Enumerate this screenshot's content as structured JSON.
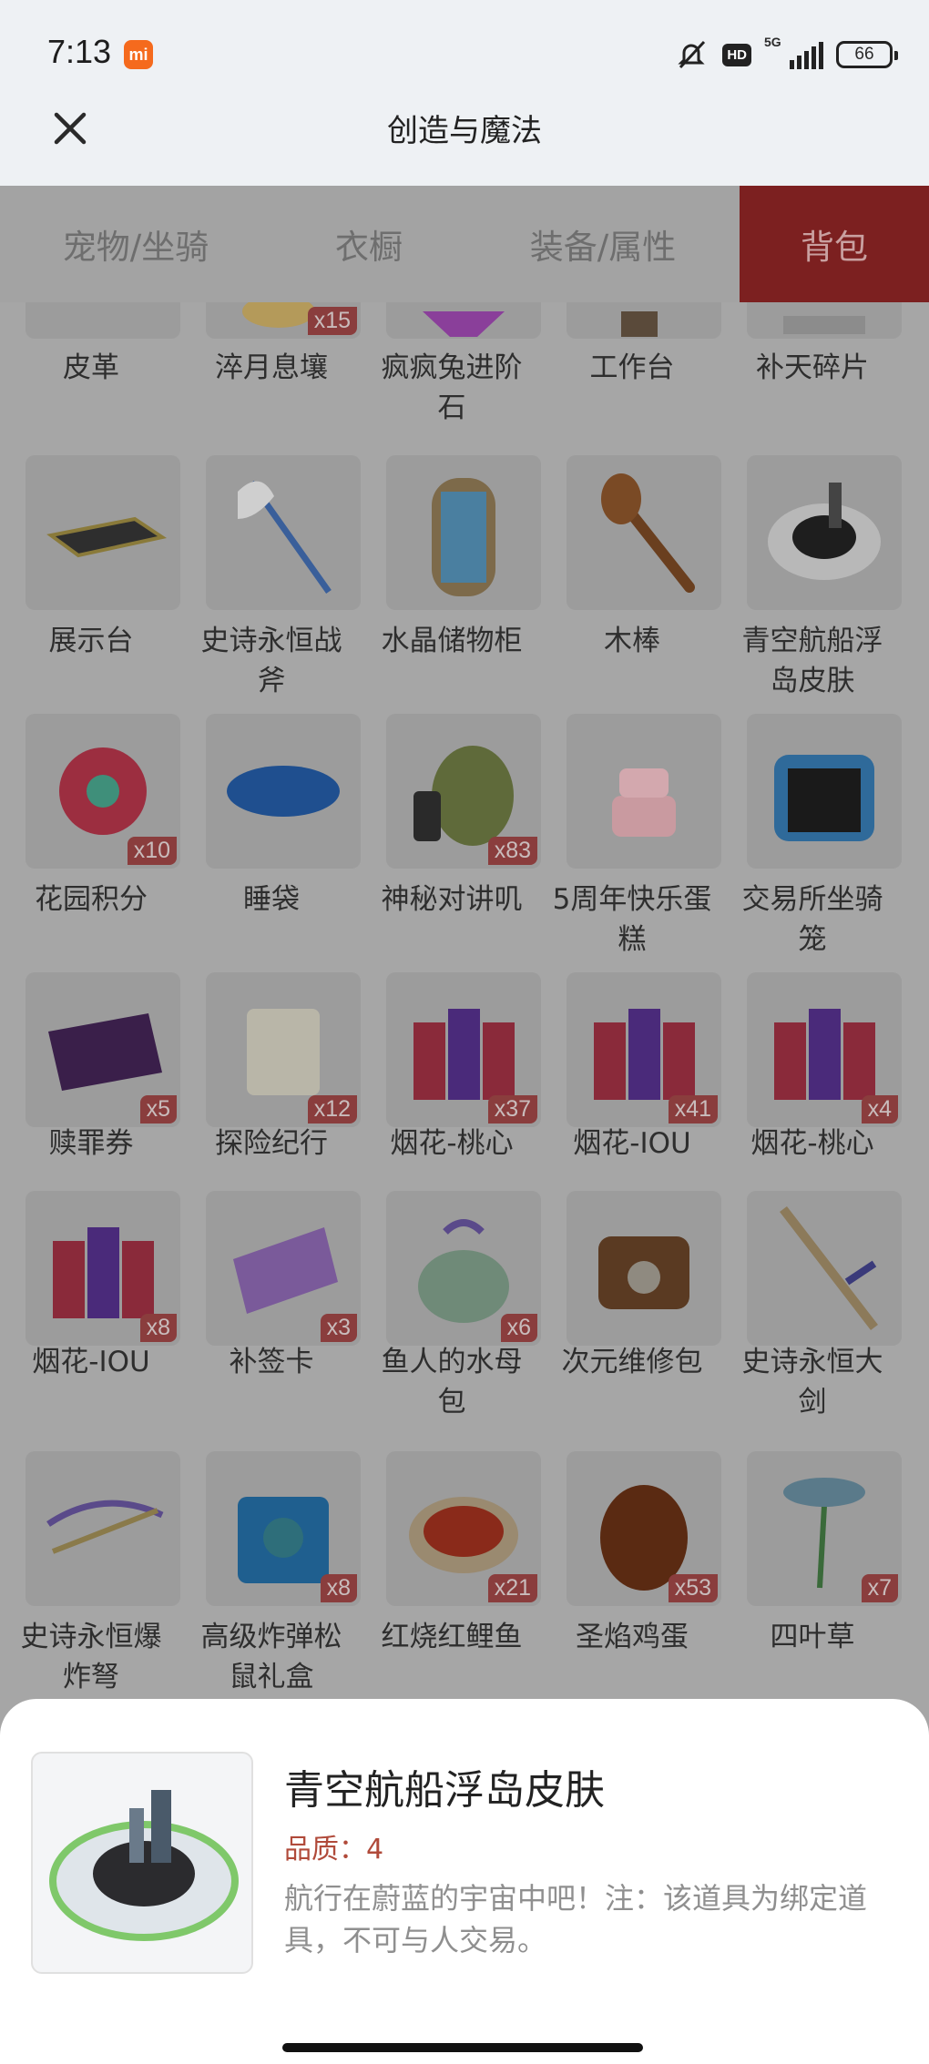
{
  "status_bar": {
    "time": "7:13",
    "brand_badge": "mi",
    "hd": "HD",
    "network": "5G",
    "battery": "66"
  },
  "header": {
    "title": "创造与魔法",
    "close_icon": "close-icon"
  },
  "tabs": [
    {
      "label": "宠物/坐骑",
      "active": false
    },
    {
      "label": "衣橱",
      "active": false
    },
    {
      "label": "装备/属性",
      "active": false
    },
    {
      "label": "背包",
      "active": true
    }
  ],
  "items": [
    {
      "name": "皮革",
      "qty": "",
      "icon": "leather-icon"
    },
    {
      "name": "淬月息壤",
      "qty": "x15",
      "icon": "soil-icon"
    },
    {
      "name": "疯疯兔进阶石",
      "qty": "",
      "icon": "gem-icon"
    },
    {
      "name": "工作台",
      "qty": "",
      "icon": "workbench-icon"
    },
    {
      "name": "补天碎片",
      "qty": "",
      "icon": "fragment-icon"
    },
    {
      "name": "展示台",
      "qty": "",
      "icon": "display-stand-icon"
    },
    {
      "name": "史诗永恒战斧",
      "qty": "",
      "icon": "battle-axe-icon"
    },
    {
      "name": "水晶储物柜",
      "qty": "",
      "icon": "crystal-cabinet-icon"
    },
    {
      "name": "木棒",
      "qty": "",
      "icon": "wooden-club-icon"
    },
    {
      "name": "青空航船浮岛皮肤",
      "qty": "",
      "icon": "floating-island-icon"
    },
    {
      "name": "花园积分",
      "qty": "x10",
      "icon": "flower-icon"
    },
    {
      "name": "睡袋",
      "qty": "",
      "icon": "sleeping-bag-icon"
    },
    {
      "name": "神秘对讲叽",
      "qty": "x83",
      "icon": "walkie-bird-icon"
    },
    {
      "name": "5周年快乐蛋糕",
      "qty": "",
      "icon": "cake-icon"
    },
    {
      "name": "交易所坐骑笼",
      "qty": "",
      "icon": "mount-cage-icon"
    },
    {
      "name": "赎罪券",
      "qty": "x5",
      "icon": "ticket-icon"
    },
    {
      "name": "探险纪行",
      "qty": "x12",
      "icon": "scroll-icon"
    },
    {
      "name": "烟花-桃心",
      "qty": "x37",
      "icon": "firework-icon"
    },
    {
      "name": "烟花-IOU",
      "qty": "x41",
      "icon": "firework-icon"
    },
    {
      "name": "烟花-桃心",
      "qty": "x4",
      "icon": "firework-icon"
    },
    {
      "name": "烟花-IOU",
      "qty": "x8",
      "icon": "firework-icon"
    },
    {
      "name": "补签卡",
      "qty": "x3",
      "icon": "sign-card-icon"
    },
    {
      "name": "鱼人的水母包",
      "qty": "x6",
      "icon": "jellyfish-bag-icon"
    },
    {
      "name": "次元维修包",
      "qty": "",
      "icon": "repair-kit-icon"
    },
    {
      "name": "史诗永恒大剑",
      "qty": "",
      "icon": "great-sword-icon"
    },
    {
      "name": "史诗永恒爆炸弩",
      "qty": "",
      "icon": "crossbow-icon"
    },
    {
      "name": "高级炸弹松鼠礼盒",
      "qty": "x8",
      "icon": "gift-box-icon"
    },
    {
      "name": "红烧红鲤鱼",
      "qty": "x21",
      "icon": "braised-fish-icon"
    },
    {
      "name": "圣焰鸡蛋",
      "qty": "x53",
      "icon": "egg-icon"
    },
    {
      "name": "四叶草",
      "qty": "x7",
      "icon": "clover-icon"
    }
  ],
  "detail": {
    "name": "青空航船浮岛皮肤",
    "quality": "品质：4",
    "description": "航行在蔚蓝的宇宙中吧！注：该道具为绑定道具，不可与人交易。",
    "icon": "floating-island-icon"
  }
}
